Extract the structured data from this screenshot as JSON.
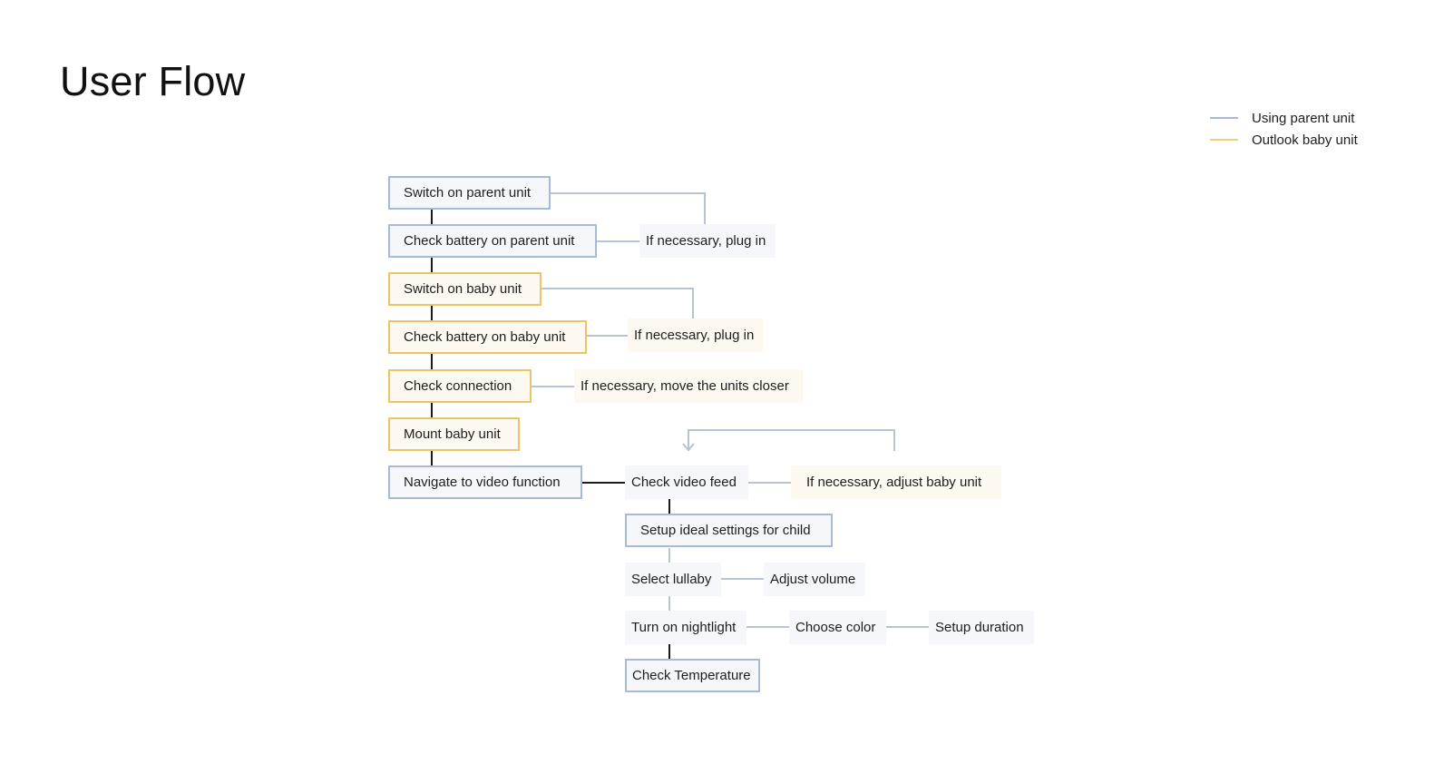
{
  "title": "User Flow",
  "colors": {
    "parent_border": "#a9b9d8",
    "parent_fill": "#f5f7fb",
    "baby_border": "#ecc468",
    "baby_fill": "#fdf8f0",
    "main_connector": "#1a1a1a",
    "side_connector": "#b8c3d3"
  },
  "legend": [
    {
      "label": "Using parent unit",
      "color": "#a9b9d8"
    },
    {
      "label": "Outlook baby unit",
      "color": "#f1cf7a"
    }
  ],
  "nodes": {
    "switch_parent": "Switch on parent unit",
    "check_battery_parent": "Check battery on parent unit",
    "plug_in_parent": "If necessary, plug in",
    "switch_baby": "Switch on baby unit",
    "check_battery_baby": "Check battery on baby unit",
    "plug_in_baby": "If necessary, plug in",
    "check_connection": "Check connection",
    "move_closer": "If necessary, move the units closer",
    "mount_baby": "Mount baby unit",
    "navigate_video": "Navigate to video function",
    "check_video_feed": "Check video feed",
    "adjust_baby_unit": "If necessary, adjust baby unit",
    "setup_ideal_settings": "Setup ideal settings for child",
    "select_lullaby": "Select lullaby",
    "adjust_volume": "Adjust volume",
    "turn_on_nightlight": "Turn on nightlight",
    "choose_color": "Choose color",
    "setup_duration": "Setup duration",
    "check_temperature": "Check Temperature"
  }
}
